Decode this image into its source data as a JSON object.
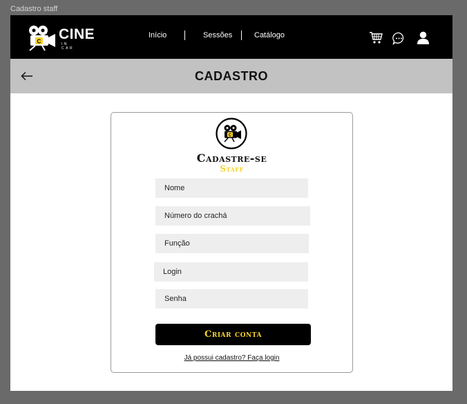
{
  "frame": {
    "label": "Cadastro staff"
  },
  "brand": {
    "name": "CINE",
    "tagline": "IN CAR"
  },
  "nav": {
    "links": [
      {
        "label": "Início"
      },
      {
        "label": "Sessões"
      },
      {
        "label": "Catálogo"
      }
    ],
    "icons": [
      "cart-icon",
      "chat-icon",
      "user-icon"
    ]
  },
  "header": {
    "title": "CADASTRO",
    "back_icon": "arrow-left-icon"
  },
  "form": {
    "title": "Cadastre-se",
    "subtitle": "Staff",
    "fields": [
      {
        "placeholder": "Nome"
      },
      {
        "placeholder": "Número do crachá"
      },
      {
        "placeholder": "Função"
      },
      {
        "placeholder": "Login"
      },
      {
        "placeholder": "Senha"
      }
    ],
    "submit_label": "Criar conta",
    "login_prompt": "Já possui cadastro? Faça login"
  },
  "colors": {
    "nav_bg": "#000000",
    "header_bg": "#c2c2c2",
    "accent": "#f6d22c",
    "field_bg": "#eeeeee"
  }
}
